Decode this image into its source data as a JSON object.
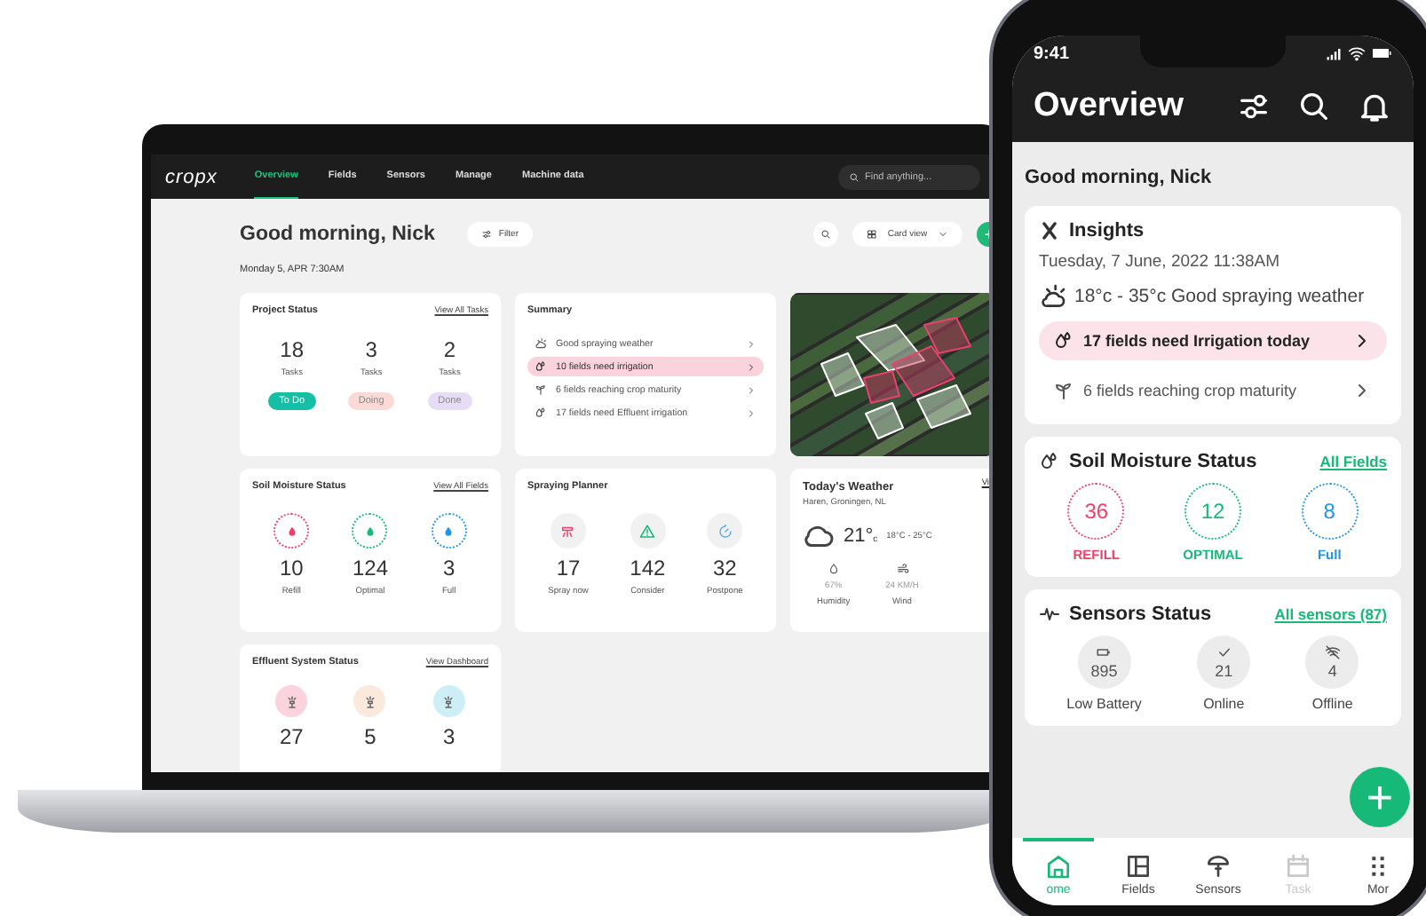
{
  "laptop": {
    "logo": "cropx",
    "nav": [
      {
        "label": "Overview",
        "selected": true
      },
      {
        "label": "Fields",
        "selected": false
      },
      {
        "label": "Sensors",
        "selected": false
      },
      {
        "label": "Manage",
        "selected": false
      },
      {
        "label": "Machine data",
        "selected": false
      }
    ],
    "search": {
      "placeholder": "Find anything..."
    },
    "greeting": "Good morning, Nick",
    "filter_button": "Filter",
    "view_select": "Card view",
    "add_button": "+",
    "date": "Monday 5, APR 7:30AM",
    "project_status": {
      "title": "Project Status",
      "link": "View All Tasks",
      "items": [
        {
          "count": "18",
          "unit": "Tasks",
          "status": "To Do",
          "color": "#14bfa6"
        },
        {
          "count": "3",
          "unit": "Tasks",
          "status": "Doing",
          "color": "#fbd9d6"
        },
        {
          "count": "2",
          "unit": "Tasks",
          "status": "Done",
          "color": "#e6dcf5"
        }
      ]
    },
    "summary": {
      "title": "Summary",
      "items": [
        {
          "kind": "weather",
          "text": "Good spraying weather",
          "selected": false
        },
        {
          "kind": "drops",
          "text": "10 fields need irrigation",
          "selected": true
        },
        {
          "kind": "sprout",
          "text": "6 fields reaching crop maturity",
          "selected": false
        },
        {
          "kind": "drops",
          "text": "17 fields need Effluent irrigation",
          "selected": false
        }
      ]
    },
    "soil_moisture": {
      "title": "Soil Moisture Status",
      "link": "View All Fields",
      "items": [
        {
          "count": "10",
          "label": "Refill",
          "color": "#f0406a"
        },
        {
          "count": "124",
          "label": "Optimal",
          "color": "#17b978"
        },
        {
          "count": "3",
          "label": "Full",
          "color": "#2196e8"
        }
      ]
    },
    "spraying_planner": {
      "title": "Spraying Planner",
      "items": [
        {
          "kind": "sprayer",
          "count": "17",
          "label": "Spray now"
        },
        {
          "kind": "warning",
          "count": "142",
          "label": "Consider"
        },
        {
          "kind": "timer",
          "count": "32",
          "label": "Postpone"
        }
      ]
    },
    "weather": {
      "title": "Today's Weather",
      "location": "Haren, Groningen, NL",
      "temperature": "21°",
      "unit": "c",
      "range": "18°C - 25°C",
      "link": "Vi",
      "stats": [
        {
          "kind": "drop",
          "value": "67%",
          "label": "Humidity"
        },
        {
          "kind": "wind",
          "value": "24 KM/H",
          "label": "Wind"
        }
      ]
    },
    "effluent": {
      "title": "Effluent System Status",
      "link": "View Dashboard",
      "items": [
        {
          "count": "27",
          "color": "#fbd3dd"
        },
        {
          "count": "5",
          "color": "#fbe9dc"
        },
        {
          "count": "3",
          "color": "#cdeef7"
        }
      ]
    }
  },
  "phone": {
    "time": "9:41",
    "title": "Overview",
    "greeting": "Good morning, Nick",
    "insights": {
      "title": "Insights",
      "date": "Tuesday, 7 June, 2022 11:38AM",
      "weather": "18°c - 35°c Good spraying weather",
      "items": [
        {
          "kind": "drops",
          "text": "17 fields need Irrigation today",
          "selected": true
        },
        {
          "kind": "sprout",
          "text": "6 fields reaching crop maturity",
          "selected": false
        }
      ]
    },
    "soil_moisture": {
      "title": "Soil Moisture Status",
      "link": "All Fields",
      "items": [
        {
          "count": "36",
          "label": "REFILL",
          "color": "#f0406a"
        },
        {
          "count": "12",
          "label": "OPTIMAL",
          "color": "#17b978"
        },
        {
          "count": "8",
          "label": "Full",
          "color": "#2196e8"
        }
      ]
    },
    "sensors": {
      "title": "Sensors Status",
      "link": "All sensors (87)",
      "items": [
        {
          "kind": "battery",
          "count": "895",
          "label": "Low Battery"
        },
        {
          "kind": "check",
          "count": "21",
          "label": "Online"
        },
        {
          "kind": "offline",
          "count": "4",
          "label": "Offline"
        }
      ]
    },
    "fab": "+",
    "tabs": [
      {
        "kind": "home",
        "label": "ome",
        "selected": true,
        "disabled": false
      },
      {
        "kind": "fields",
        "label": "Fields",
        "selected": false,
        "disabled": false
      },
      {
        "kind": "sensor",
        "label": "Sensors",
        "selected": false,
        "disabled": false
      },
      {
        "kind": "calendar",
        "label": "Task",
        "selected": false,
        "disabled": true
      },
      {
        "kind": "dots",
        "label": "Mor",
        "selected": false,
        "disabled": false
      }
    ]
  }
}
